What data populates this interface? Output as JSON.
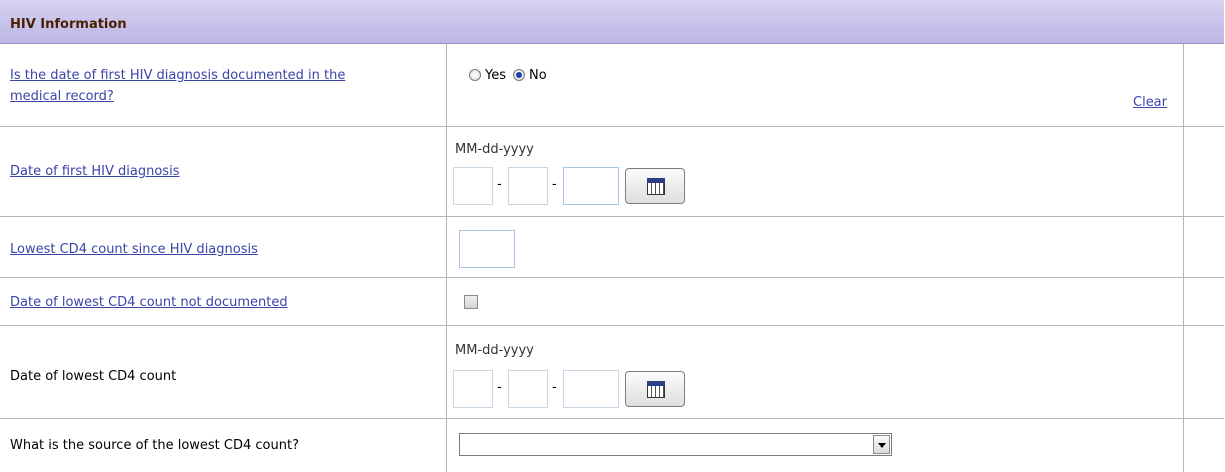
{
  "section": {
    "title": "HIV Information"
  },
  "rows": [
    {
      "label": "Is the date of first HIV diagnosis documented in the medical record?",
      "label_line1": "Is the date of first HIV diagnosis documented in the",
      "label_line2": "medical record?",
      "radio_yes": "Yes",
      "radio_no": "No",
      "selected": "No",
      "clear": "Clear"
    },
    {
      "label": "Date of first HIV diagnosis",
      "format": "MM-dd-yyyy",
      "month": "",
      "day": "",
      "year": ""
    },
    {
      "label": "Lowest CD4 count since HIV diagnosis",
      "value": ""
    },
    {
      "label": "Date of lowest CD4 count not documented",
      "checked": false
    },
    {
      "label": "Date of lowest CD4 count",
      "format": "MM-dd-yyyy",
      "month": "",
      "day": "",
      "year": ""
    },
    {
      "label": "What is the source of the lowest CD4 count?",
      "selected_option": ""
    }
  ],
  "icons": {
    "calendar": "calendar-icon",
    "dropdown": "chevron-down-icon"
  },
  "colors": {
    "header_bg": "#bcb6e6",
    "header_text": "#4a1f00",
    "link": "#3a44a8"
  }
}
